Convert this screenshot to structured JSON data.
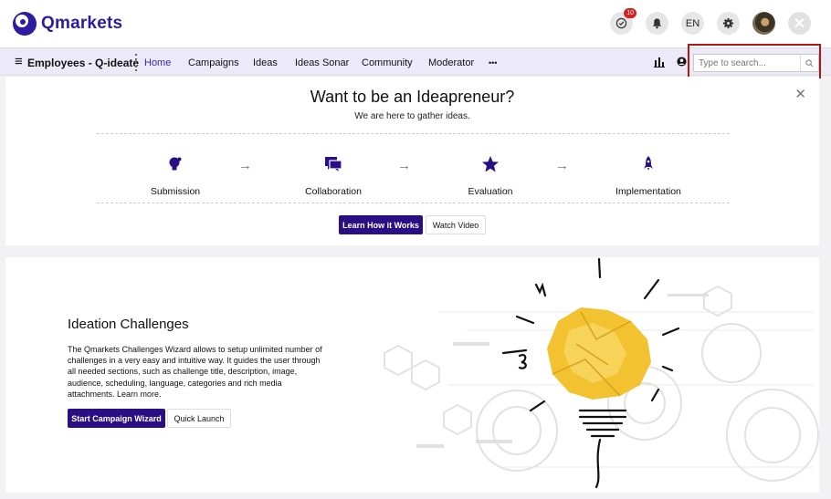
{
  "header": {
    "logo_text": "Qmarkets",
    "notifications_count": "10",
    "language": "EN"
  },
  "nav": {
    "brand": "Employees - Q-ideate",
    "items": [
      "Home",
      "Campaigns",
      "Ideas",
      "Ideas Sonar",
      "Community",
      "Moderator"
    ],
    "more": "•••",
    "search_placeholder": "Type to search..."
  },
  "intro": {
    "title": "Want to be an Ideapreneur?",
    "subtitle": "We are here to gather ideas.",
    "steps": [
      {
        "label": "Submission",
        "icon": "lightbulb-icon"
      },
      {
        "label": "Collaboration",
        "icon": "chat-bubbles-icon"
      },
      {
        "label": "Evaluation",
        "icon": "star-icon"
      },
      {
        "label": "Implementation",
        "icon": "rocket-icon"
      }
    ],
    "learn_button": "Learn How it Works",
    "video_button": "Watch Video"
  },
  "challenges": {
    "title": "Ideation Challenges",
    "body": "The Qmarkets Challenges Wizard allows to setup unlimited number of challenges in a very easy and intuitive way. It guides the user through all needed sections, such as challenge title, description, image, audience, scheduling, language, categories and rich media attachments. Learn more.",
    "wizard_button": "Start Campaign Wizard",
    "quick_button": "Quick Launch"
  },
  "colors": {
    "brand": "#2a0f84",
    "nav_bg": "#eceaf8",
    "accent_highlight": "#b01616"
  }
}
